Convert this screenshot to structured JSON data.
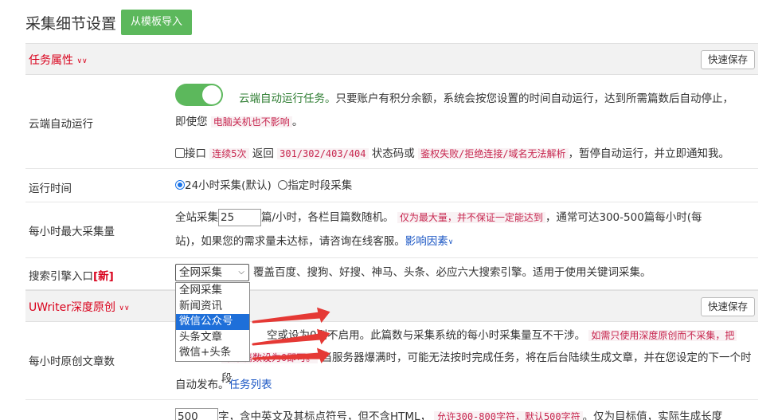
{
  "header": {
    "title": "采集细节设置",
    "import_button": "从模板导入"
  },
  "section_task": {
    "title": "任务属性",
    "save": "快速保存"
  },
  "cloud_run": {
    "label": "云端自动运行",
    "toggle_on": true,
    "line1_green": "云端自动运行任务。",
    "line1_rest": "只要账户有积分余额，系统会按您设置的时间自动运行，达到所需篇数后自动停止，",
    "line2_pre": "即使您",
    "line2_code": "电脑关机也不影响",
    "line2_post": "。",
    "checkbox_label": "接口",
    "cb_code1": "连续5次",
    "cb_text1": "返回",
    "cb_code2": "301/302/403/404",
    "cb_text2": "状态码或",
    "cb_code3": "鉴权失败/拒绝连接/域名无法解析",
    "cb_text3": "，暂停自动运行，并立即通知我。"
  },
  "run_time": {
    "label": "运行时间",
    "option1": "24小时采集(默认)",
    "option2": "指定时段采集"
  },
  "max_per_hour": {
    "label": "每小时最大采集量",
    "pre": "全站采集",
    "value": "25",
    "post": "篇/小时，各栏目篇数随机。",
    "code": "仅为最大量，并不保证一定能达到",
    "rest": "，通常可达300-500篇每小时(每",
    "line2": "站)，如果您的需求量未达标，请咨询在线客服。",
    "link": "影响因素"
  },
  "search_engine": {
    "label": "搜索引擎入口",
    "badge": "[新]",
    "selected": "全网采集",
    "desc": "覆盖百度、搜狗、好搜、神马、头条、必应六大搜索引擎。适用于使用关键词采集。",
    "options": [
      "全网采集",
      "新闻资讯",
      "微信公众号",
      "头条文章",
      "微信+头条"
    ]
  },
  "section_uwriter": {
    "title": "UWriter深度原创",
    "save": "快速保存"
  },
  "original_per_hour": {
    "label": "每小时原创文章数",
    "line1_partial": "空或设为0则不启用。此篇数与采集系统的每小时采集量互不干涉。",
    "line1_code": "如需只使用深度原创而不采集，把",
    "line2_code": "采集篇数设为0即可。",
    "line2_rest": "当服务器爆满时，可能无法按时完成任务，将在后台陆续生成文章，并在您设定的下一个时段",
    "line3_pre": "自动发布。",
    "line3_link": "任务列表"
  },
  "word_count": {
    "value": "500",
    "pre": "字，含中英文及其标点符号，但不含HTML，",
    "code": "允许300-800字符，默认500字符",
    "post": "。仅为目标值，实际生成长度"
  },
  "colors": {
    "accent_red": "#d9001b",
    "green": "#5cb85c",
    "link": "#1a56c4",
    "select_blue": "#1e6fd9",
    "arrow_red": "#e53935"
  }
}
